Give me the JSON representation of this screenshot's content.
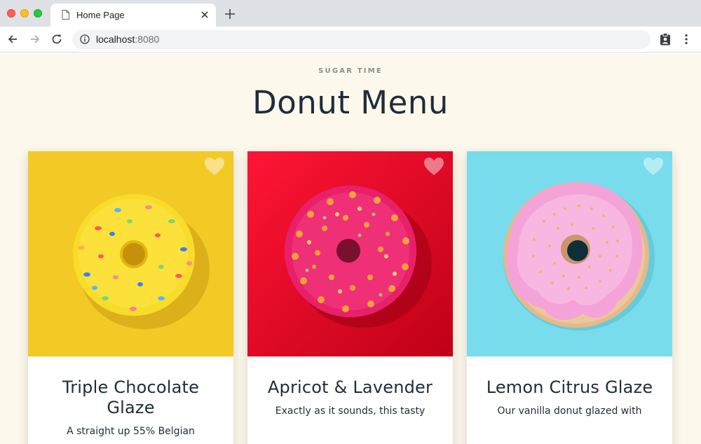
{
  "browser": {
    "tab_title": "Home Page",
    "url_host": "localhost",
    "url_port": ":8080"
  },
  "page": {
    "eyebrow": "SUGAR TIME",
    "title": "Donut Menu"
  },
  "cards": [
    {
      "name": "Triple Chocolate Glaze",
      "description": "A straight up 55% Belgian",
      "background_color": "#f3c926",
      "favorite_icon": "heart-icon"
    },
    {
      "name": "Apricot & Lavender",
      "description": "Exactly as it sounds, this tasty",
      "background_color": "#e4082b",
      "favorite_icon": "heart-icon"
    },
    {
      "name": "Lemon Citrus Glaze",
      "description": "Our vanilla donut glazed with",
      "background_color": "#78dcec",
      "favorite_icon": "heart-icon"
    }
  ],
  "colors": {
    "page_background": "#fcf8ec",
    "heading": "#1e2d3a",
    "eyebrow": "#8a9289"
  }
}
